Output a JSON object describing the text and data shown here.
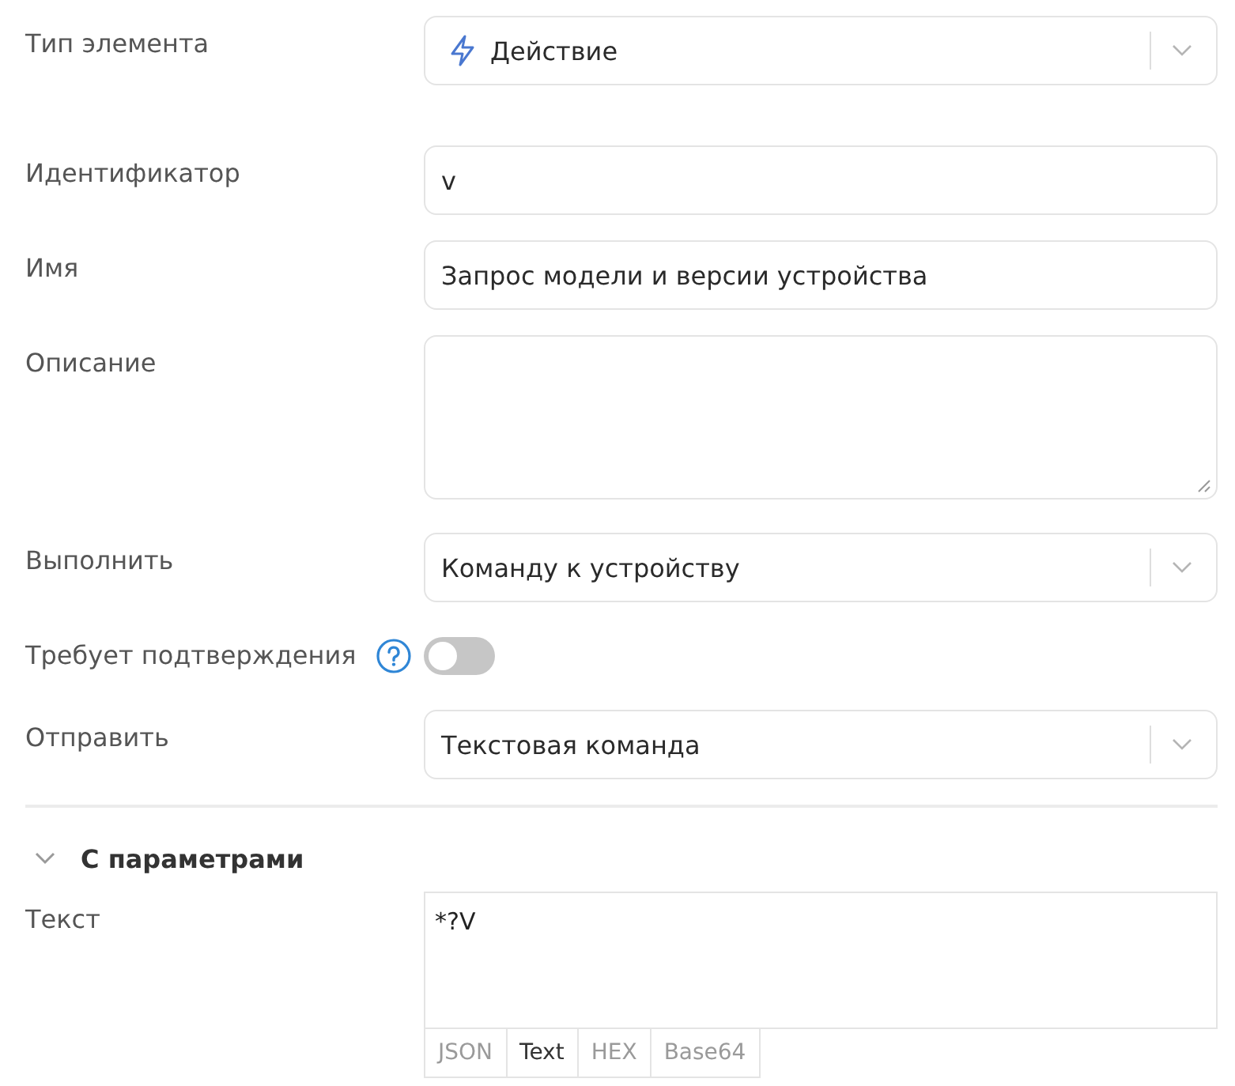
{
  "fields": [
    {
      "kind": "icon_select",
      "label": "Тип элемента",
      "value": "Действие"
    },
    {
      "kind": "input",
      "label": "Идентификатор",
      "value": "v"
    },
    {
      "kind": "input",
      "label": "Имя",
      "value": "Запрос модели и версии устройства"
    },
    {
      "kind": "textarea",
      "label": "Описание"
    },
    {
      "kind": "select",
      "label": "Выполнить",
      "value": "Команду к устройству"
    },
    {
      "kind": "toggle",
      "label": "Требует подтверждения",
      "help": true,
      "on": false
    },
    {
      "kind": "select",
      "label": "Отправить",
      "value": "Текстовая команда"
    }
  ],
  "parameters": {
    "title": "С параметрами",
    "expanded": true,
    "fields": [
      {
        "kind": "code",
        "label": "Текст",
        "value": "*?V",
        "formats": [
          {
            "label": "JSON",
            "selected": false
          },
          {
            "label": "Text",
            "selected": true
          },
          {
            "label": "HEX",
            "selected": false
          },
          {
            "label": "Base64",
            "selected": false
          }
        ]
      }
    ]
  }
}
